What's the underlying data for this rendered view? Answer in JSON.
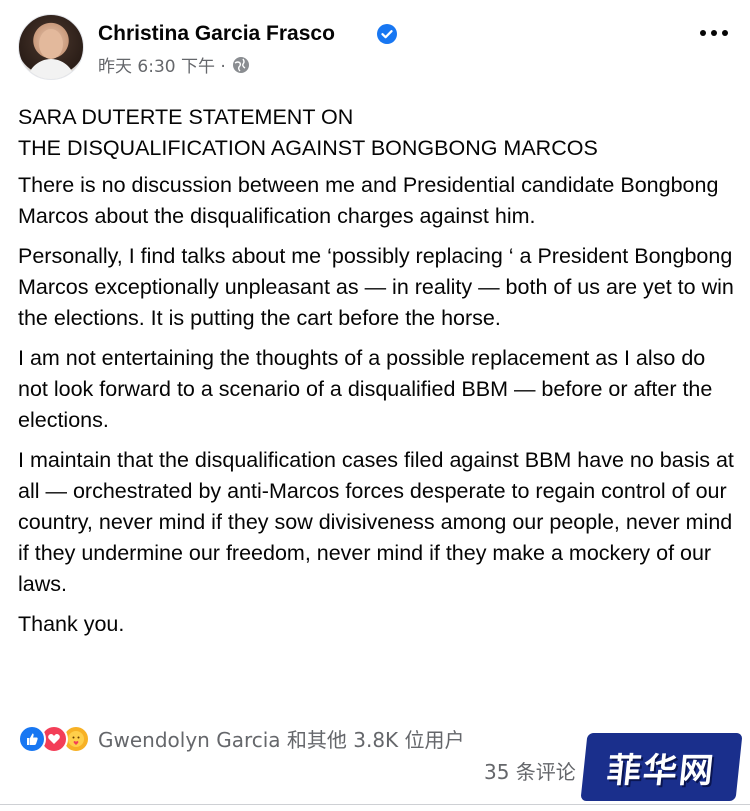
{
  "post": {
    "author": "Christina Garcia Frasco",
    "timestamp": "昨天 6:30 下午 ·",
    "heading_line1": "SARA DUTERTE STATEMENT ON",
    "heading_line2": "THE DISQUALIFICATION AGAINST BONGBONG MARCOS",
    "paragraphs": [
      "There is no discussion between me and Presidential candidate Bongbong Marcos about the disqualification charges against him.",
      "Personally, I find talks about me ‘possibly replacing ‘ a President Bongbong Marcos exceptionally unpleasant as — in reality — both of us are yet to win the elections. It is putting the cart before the horse.",
      "I am not entertaining the thoughts of a possible replacement as I also do not look forward to a scenario of a disqualified BBM — before or after the elections.",
      "I maintain that the disqualification cases filed against BBM have no basis at all — orchestrated by anti-Marcos forces desperate to regain control of our country, never mind if they sow divisiveness among our people, never mind if they undermine our freedom, never mind if they make a mockery of our laws.",
      "Thank you."
    ]
  },
  "engagement": {
    "reactions_text": "Gwendolyn Garcia 和其他 3.8K 位用户",
    "comments_text": "35 条评论"
  },
  "watermark": {
    "text": "菲华网"
  },
  "icons": {
    "verified": "verified-badge-icon",
    "privacy": "globe-icon",
    "more": "more-options-icon",
    "reactions": [
      "like-icon",
      "love-icon",
      "care-icon"
    ]
  },
  "colors": {
    "accent": "#1877f2",
    "secondary_text": "#65676b",
    "watermark_bg": "#1a2f8c"
  }
}
